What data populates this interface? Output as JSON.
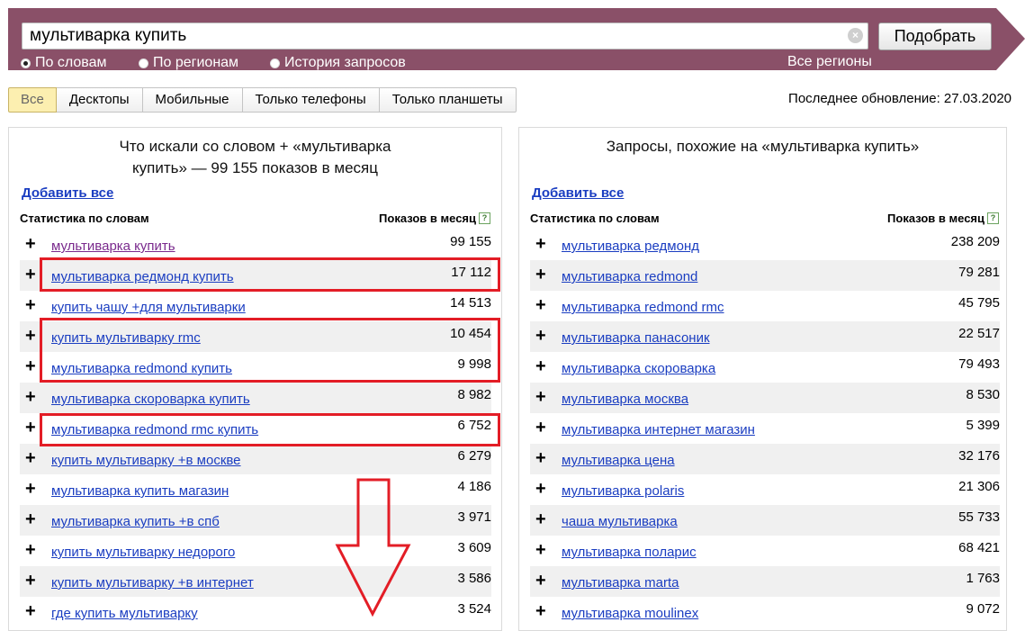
{
  "search": {
    "query": "мультиварка купить",
    "submit_label": "Подобрать"
  },
  "modes": [
    {
      "label": "По словам",
      "checked": true
    },
    {
      "label": "По регионам",
      "checked": false
    },
    {
      "label": "История запросов",
      "checked": false
    }
  ],
  "regions_label": "Все регионы",
  "tabs": [
    "Все",
    "Десктопы",
    "Мобильные",
    "Только телефоны",
    "Только планшеты"
  ],
  "last_update": "Последнее обновление: 27.03.2020",
  "left_panel": {
    "title_line1": "Что искали со словом + «мультиварка",
    "title_line2": "купить» — 99 155 показов в месяц",
    "add_all": "Добавить все",
    "col_stats": "Статистика по словам",
    "col_shows": "Показов в месяц",
    "rows": [
      {
        "phrase": "мультиварка купить",
        "count": "99 155"
      },
      {
        "phrase": "мультиварка редмонд купить",
        "count": "17 112"
      },
      {
        "phrase": "купить чашу +для мультиварки",
        "count": "14 513"
      },
      {
        "phrase": "купить мультиварку rmc",
        "count": "10 454"
      },
      {
        "phrase": "мультиварка redmond купить",
        "count": "9 998"
      },
      {
        "phrase": "мультиварка скороварка купить",
        "count": "8 982"
      },
      {
        "phrase": "мультиварка redmond rmc купить",
        "count": "6 752"
      },
      {
        "phrase": "купить мультиварку +в москве",
        "count": "6 279"
      },
      {
        "phrase": "мультиварка купить магазин",
        "count": "4 186"
      },
      {
        "phrase": "мультиварка купить +в спб",
        "count": "3 971"
      },
      {
        "phrase": "купить мультиварку недорого",
        "count": "3 609"
      },
      {
        "phrase": "купить мультиварку +в интернет",
        "count": "3 586"
      },
      {
        "phrase": "где купить мультиварку",
        "count": "3 524"
      }
    ]
  },
  "right_panel": {
    "title": "Запросы, похожие на «мультиварка купить»",
    "add_all": "Добавить все",
    "col_stats": "Статистика по словам",
    "col_shows": "Показов в месяц",
    "rows": [
      {
        "phrase": "мультиварка редмонд",
        "count": "238 209"
      },
      {
        "phrase": "мультиварка redmond",
        "count": "79 281"
      },
      {
        "phrase": "мультиварка redmond rmc",
        "count": "45 795"
      },
      {
        "phrase": "мультиварка панасоник",
        "count": "22 517"
      },
      {
        "phrase": "мультиварка скороварка",
        "count": "79 493"
      },
      {
        "phrase": "мультиварка москва",
        "count": "8 530"
      },
      {
        "phrase": "мультиварка интернет магазин",
        "count": "5 399"
      },
      {
        "phrase": "мультиварка цена",
        "count": "32 176"
      },
      {
        "phrase": "мультиварка polaris",
        "count": "21 306"
      },
      {
        "phrase": "чаша мультиварка",
        "count": "55 733"
      },
      {
        "phrase": "мультиварка поларис",
        "count": "68 421"
      },
      {
        "phrase": "мультиварка marta",
        "count": "1 763"
      },
      {
        "phrase": "мультиварка moulinex",
        "count": "9 072"
      }
    ]
  },
  "colors": {
    "header_band": "#8a5068",
    "link": "#1a3dc1",
    "visited_link": "#7a2a8d",
    "annotation": "#e31d26"
  }
}
